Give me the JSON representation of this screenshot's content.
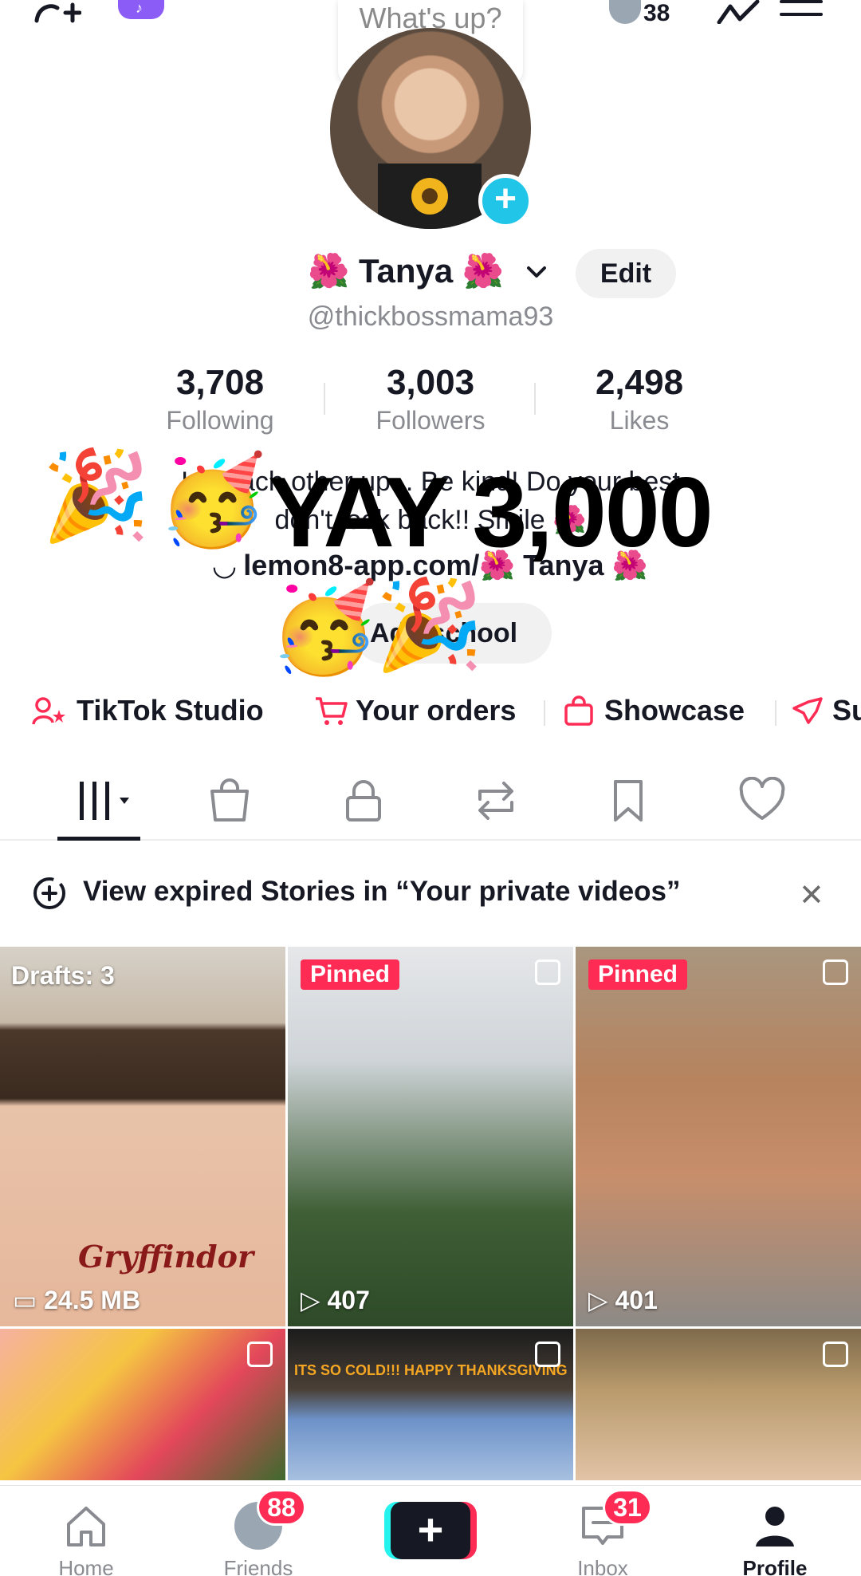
{
  "top_bar": {
    "whatsup": "What's up?",
    "visitor_count": "38"
  },
  "profile": {
    "name": "🌺 Tanya 🌺",
    "edit_label": "Edit",
    "handle": "@thickbossmama93"
  },
  "stats": [
    {
      "value": "3,708",
      "label": "Following"
    },
    {
      "value": "3,003",
      "label": "Followers"
    },
    {
      "value": "2,498",
      "label": "Likes"
    }
  ],
  "bio": {
    "line1": "Lift each other up... Be kind! Do your best",
    "line2": "don't look back!! Smile 🌺",
    "link": "lemon8-app.com/🌺 Tanya 🌺",
    "school_label": "Add school"
  },
  "overlay": {
    "text": "YAY 3,000"
  },
  "shortcuts": [
    {
      "label": "TikTok Studio"
    },
    {
      "label": "Your orders"
    },
    {
      "label": "Showcase"
    },
    {
      "label": "Su"
    }
  ],
  "banner": {
    "text": "View expired Stories in “Your private videos”"
  },
  "grid": [
    {
      "label": "Drafts: 3",
      "footer": "24.5 MB"
    },
    {
      "label": "Pinned",
      "footer": "407"
    },
    {
      "label": "Pinned",
      "footer": "401"
    },
    {
      "label": "",
      "footer": ""
    },
    {
      "label": "ITS SO COLD!!! HAPPY THANKSGIVING",
      "footer": ""
    },
    {
      "label": "",
      "footer": ""
    }
  ],
  "draft_overlay_text": "Gryffindor",
  "bottom_nav": {
    "home": "Home",
    "friends": "Friends",
    "friends_badge": "88",
    "inbox": "Inbox",
    "inbox_badge": "31",
    "profile": "Profile"
  },
  "colors": {
    "accent": "#fe2c55",
    "cyan": "#25f4ee",
    "text": "#161823",
    "muted": "#8a8b91"
  }
}
